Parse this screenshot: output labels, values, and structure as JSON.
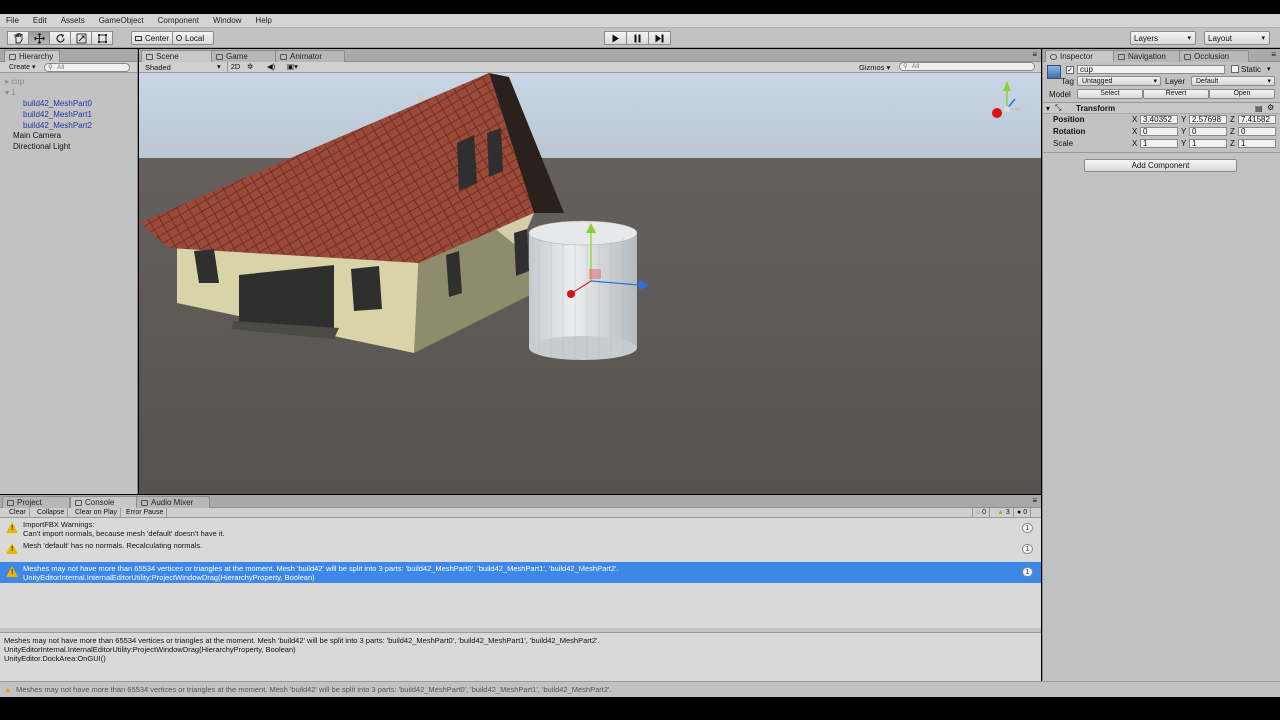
{
  "menu": [
    "File",
    "Edit",
    "Assets",
    "GameObject",
    "Component",
    "Window",
    "Help"
  ],
  "toolbar": {
    "pivot_label": "Center",
    "space_label": "Local",
    "layers_label": "Layers",
    "layout_label": "Layout"
  },
  "hierarchy": {
    "tab": "Hierarchy",
    "create_label": "Create",
    "search_placeholder": "All",
    "items": [
      {
        "label": "cup",
        "level": 0,
        "style": "grey"
      },
      {
        "label": "1",
        "level": 0,
        "style": "grey"
      },
      {
        "label": "build42_MeshPart0",
        "level": 2,
        "style": "blue"
      },
      {
        "label": "build42_MeshPart1",
        "level": 2,
        "style": "blue"
      },
      {
        "label": "build42_MeshPart2",
        "level": 2,
        "style": "blue"
      },
      {
        "label": "Main Camera",
        "level": 1,
        "style": "normal"
      },
      {
        "label": "Directional Light",
        "level": 1,
        "style": "normal"
      }
    ]
  },
  "scene": {
    "tabs": [
      "Scene",
      "Game",
      "Animator"
    ],
    "shading_mode": "Shaded",
    "mode_2d": "2D",
    "gizmos_label": "Gizmos",
    "search_placeholder": "All"
  },
  "inspector": {
    "tabs": [
      "Inspector",
      "Navigation",
      "Occlusion"
    ],
    "object_name": "cup",
    "static_label": "Static",
    "tag_label": "Tag",
    "tag_value": "Untagged",
    "layer_label": "Layer",
    "layer_value": "Default",
    "model_label": "Model",
    "model_buttons": [
      "Select",
      "Revert",
      "Open"
    ],
    "component_title": "Transform",
    "position_label": "Position",
    "rotation_label": "Rotation",
    "scale_label": "Scale",
    "position": {
      "x": "3.40352",
      "y": "2.57698",
      "z": "7.41582"
    },
    "rotation": {
      "x": "0",
      "y": "0",
      "z": "0"
    },
    "scale": {
      "x": "1",
      "y": "1",
      "z": "1"
    },
    "add_component_label": "Add Component"
  },
  "console": {
    "tabs": [
      "Project",
      "Console",
      "Audio Mixer"
    ],
    "buttons": [
      "Clear",
      "Collapse",
      "Clear on Play",
      "Error Pause"
    ],
    "counts": {
      "info": "0",
      "warning": "3",
      "error": "0"
    },
    "entries": [
      {
        "line1": "ImportFBX Warnings:",
        "line2": "Can't import normals, because mesh 'default' doesn't have it.",
        "count": "1",
        "selected": false
      },
      {
        "line1": "Mesh 'default' has no normals. Recalculating normals.",
        "line2": "",
        "count": "1",
        "selected": false
      },
      {
        "line1": "Meshes may not have more than 65534 vertices or triangles at the moment. Mesh 'build42' will be split into 3 parts: 'build42_MeshPart0', 'build42_MeshPart1', 'build42_MeshPart2'.",
        "line2": "UnityEditorInternal.InternalEditorUtility:ProjectWindowDrag(HierarchyProperty, Boolean)",
        "count": "1",
        "selected": true
      }
    ],
    "detail": [
      "Meshes may not have more than 65534 vertices or triangles at the moment. Mesh 'build42' will be split into 3 parts: 'build42_MeshPart0', 'build42_MeshPart1', 'build42_MeshPart2'.",
      "UnityEditorInternal.InternalEditorUtility:ProjectWindowDrag(HierarchyProperty, Boolean)",
      "UnityEditor.DockArea:OnGUI()"
    ]
  },
  "status_text": "Meshes may not have more than 65534 vertices or triangles at the moment. Mesh 'build42' will be split into 3 parts: 'build42_MeshPart0', 'build42_MeshPart1', 'build42_MeshPart2'.",
  "colors": {
    "selection_blue": "#3d87e6",
    "warning_yellow": "#e6b800",
    "hierarchy_blue_text": "#2334a6"
  }
}
